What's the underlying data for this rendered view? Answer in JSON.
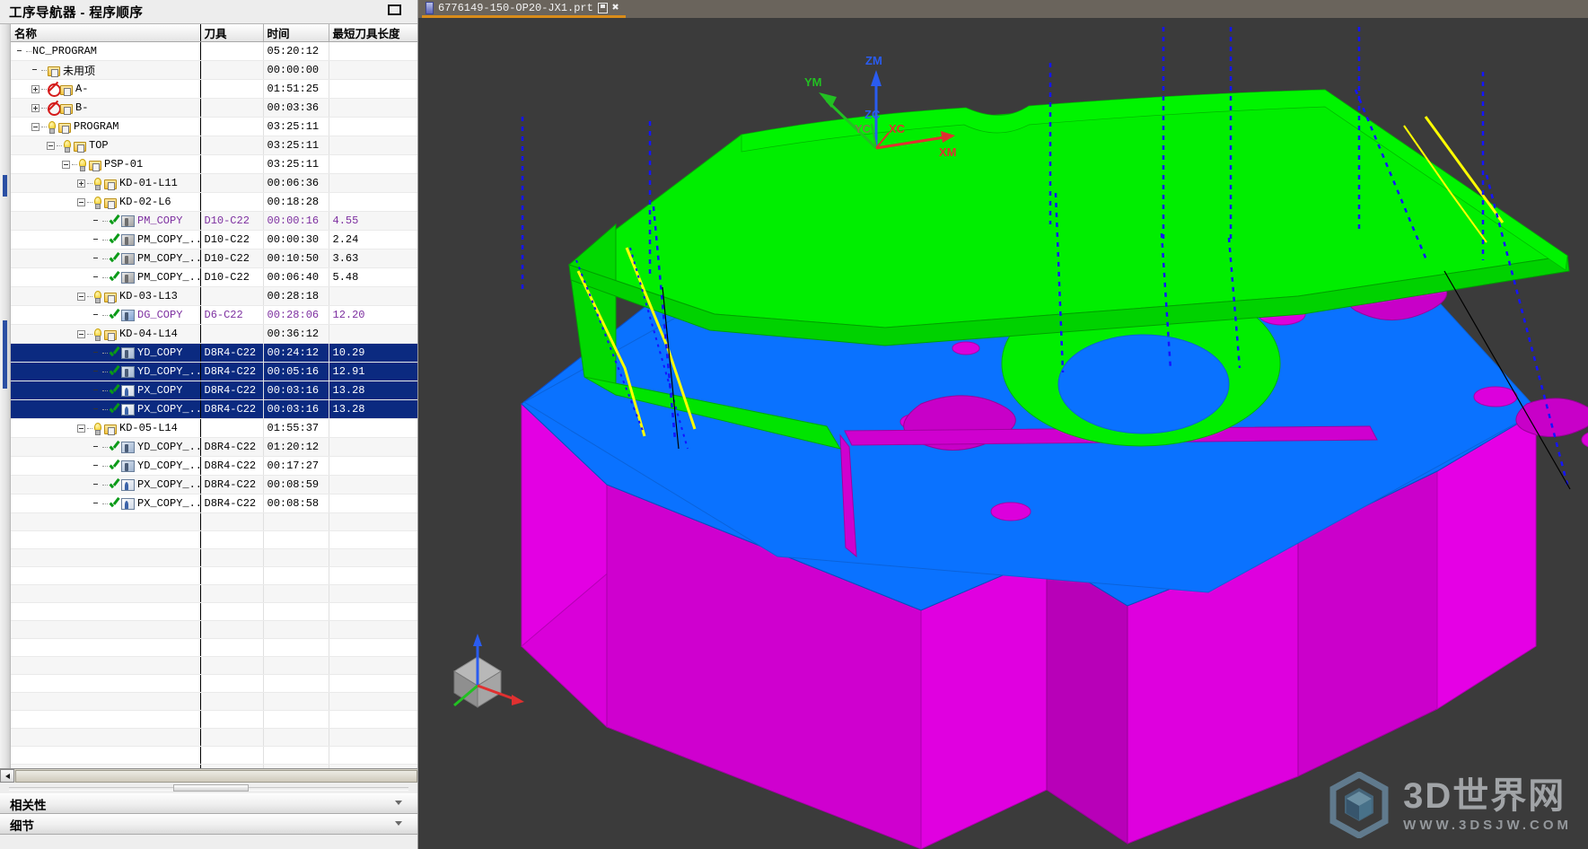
{
  "navigator": {
    "title": "工序导航器 - 程序顺序",
    "restore_button": "restore-window",
    "columns": [
      "名称",
      "刀具",
      "时间",
      "最短刀具长度"
    ],
    "rows": [
      {
        "name": "NC_PROGRAM",
        "tool": "",
        "time": "05:20:12",
        "len": "",
        "depth": 0,
        "expander": "none",
        "icon": "none",
        "purple": false,
        "selected": false
      },
      {
        "name": "未用项",
        "tool": "",
        "time": "00:00:00",
        "len": "",
        "depth": 1,
        "expander": "none",
        "icon": "folder",
        "purple": false,
        "selected": false
      },
      {
        "name": "A-",
        "tool": "",
        "time": "01:51:25",
        "len": "",
        "depth": 1,
        "expander": "plus",
        "icon": "ban-folder",
        "purple": false,
        "selected": false
      },
      {
        "name": "B-",
        "tool": "",
        "time": "00:03:36",
        "len": "",
        "depth": 1,
        "expander": "plus",
        "icon": "ban-folder",
        "purple": false,
        "selected": false
      },
      {
        "name": "PROGRAM",
        "tool": "",
        "time": "03:25:11",
        "len": "",
        "depth": 1,
        "expander": "minus",
        "icon": "lamp-folder",
        "purple": false,
        "selected": false
      },
      {
        "name": "TOP",
        "tool": "",
        "time": "03:25:11",
        "len": "",
        "depth": 2,
        "expander": "minus",
        "icon": "lamp-folder",
        "purple": false,
        "selected": false
      },
      {
        "name": "PSP-01",
        "tool": "",
        "time": "03:25:11",
        "len": "",
        "depth": 3,
        "expander": "minus",
        "icon": "lamp-folder",
        "purple": false,
        "selected": false
      },
      {
        "name": "KD-01-L11",
        "tool": "",
        "time": "00:06:36",
        "len": "",
        "depth": 4,
        "expander": "plus",
        "icon": "lamp-folder",
        "purple": false,
        "selected": false
      },
      {
        "name": "KD-02-L6",
        "tool": "",
        "time": "00:18:28",
        "len": "",
        "depth": 4,
        "expander": "minus",
        "icon": "lamp-folder",
        "purple": false,
        "selected": false
      },
      {
        "name": "PM_COPY",
        "tool": "D10-C22",
        "time": "00:00:16",
        "len": "4.55",
        "depth": 5,
        "expander": "none",
        "icon": "check-mill",
        "purple": true,
        "selected": false
      },
      {
        "name": "PM_COPY_...",
        "tool": "D10-C22",
        "time": "00:00:30",
        "len": "2.24",
        "depth": 5,
        "expander": "none",
        "icon": "check-mill",
        "purple": false,
        "selected": false
      },
      {
        "name": "PM_COPY_...",
        "tool": "D10-C22",
        "time": "00:10:50",
        "len": "3.63",
        "depth": 5,
        "expander": "none",
        "icon": "check-mill",
        "purple": false,
        "selected": false
      },
      {
        "name": "PM_COPY_...",
        "tool": "D10-C22",
        "time": "00:06:40",
        "len": "5.48",
        "depth": 5,
        "expander": "none",
        "icon": "check-mill",
        "purple": false,
        "selected": false
      },
      {
        "name": "KD-03-L13",
        "tool": "",
        "time": "00:28:18",
        "len": "",
        "depth": 4,
        "expander": "minus",
        "icon": "lamp-folder",
        "purple": false,
        "selected": false
      },
      {
        "name": "DG_COPY",
        "tool": "D6-C22",
        "time": "00:28:06",
        "len": "12.20",
        "depth": 5,
        "expander": "none",
        "icon": "check-drill",
        "purple": true,
        "selected": false
      },
      {
        "name": "KD-04-L14",
        "tool": "",
        "time": "00:36:12",
        "len": "",
        "depth": 4,
        "expander": "minus",
        "icon": "lamp-folder",
        "purple": false,
        "selected": false
      },
      {
        "name": "YD_COPY",
        "tool": "D8R4-C22",
        "time": "00:24:12",
        "len": "10.29",
        "depth": 5,
        "expander": "none",
        "icon": "check-op",
        "purple": false,
        "selected": true
      },
      {
        "name": "YD_COPY_...",
        "tool": "D8R4-C22",
        "time": "00:05:16",
        "len": "12.91",
        "depth": 5,
        "expander": "none",
        "icon": "check-op",
        "purple": false,
        "selected": true
      },
      {
        "name": "PX_COPY",
        "tool": "D8R4-C22",
        "time": "00:03:16",
        "len": "13.28",
        "depth": 5,
        "expander": "none",
        "icon": "check-px",
        "purple": false,
        "selected": true
      },
      {
        "name": "PX_COPY_...",
        "tool": "D8R4-C22",
        "time": "00:03:16",
        "len": "13.28",
        "depth": 5,
        "expander": "none",
        "icon": "check-px",
        "purple": false,
        "selected": true
      },
      {
        "name": "KD-05-L14",
        "tool": "",
        "time": "01:55:37",
        "len": "",
        "depth": 4,
        "expander": "minus",
        "icon": "lamp-folder",
        "purple": false,
        "selected": false
      },
      {
        "name": "YD_COPY_...",
        "tool": "D8R4-C22",
        "time": "01:20:12",
        "len": "",
        "depth": 5,
        "expander": "none",
        "icon": "check-op",
        "purple": false,
        "selected": false
      },
      {
        "name": "YD_COPY_...",
        "tool": "D8R4-C22",
        "time": "00:17:27",
        "len": "",
        "depth": 5,
        "expander": "none",
        "icon": "check-op",
        "purple": false,
        "selected": false
      },
      {
        "name": "PX_COPY_...",
        "tool": "D8R4-C22",
        "time": "00:08:59",
        "len": "",
        "depth": 5,
        "expander": "none",
        "icon": "check-px",
        "purple": false,
        "selected": false
      },
      {
        "name": "PX_COPY_...",
        "tool": "D8R4-C22",
        "time": "00:08:58",
        "len": "",
        "depth": 5,
        "expander": "none",
        "icon": "check-px",
        "purple": false,
        "selected": false
      }
    ],
    "empty_row_count": 15,
    "scrollbar": {
      "left_arrow": "◀"
    }
  },
  "bottom_panels": [
    {
      "title": "相关性",
      "chevron": "chevron-down-icon"
    },
    {
      "title": "细节",
      "chevron": "chevron-down-icon"
    }
  ],
  "graphics": {
    "tab": {
      "label": "6776149-150-OP20-JX1.prt",
      "save_icon": "save-icon",
      "close_icon": "close-icon",
      "part_icon": "part-icon"
    },
    "axes": {
      "wcs": [
        {
          "label": "ZM",
          "color": "#2a5cf0"
        },
        {
          "label": "YM",
          "color": "#22c022"
        },
        {
          "label": "XM",
          "color": "#e03030"
        }
      ],
      "csys": [
        {
          "label": "ZC",
          "color": "#2a5cf0"
        },
        {
          "label": "YC",
          "color": "#22c022"
        },
        {
          "label": "XC",
          "color": "#e03030"
        }
      ]
    },
    "colors": {
      "background": "#3b3b3b",
      "top_face": "#00ee00",
      "mid_face": "#0a72ff",
      "side_face": "#e000e0",
      "toolpath": "#1414ff",
      "highlight": "#ffff00"
    },
    "triad_icon": "view-triad-icon"
  },
  "watermark": {
    "title": "3D世界网",
    "url": "WWW.3DSJW.COM",
    "logo": "hexagon-cube-logo"
  }
}
